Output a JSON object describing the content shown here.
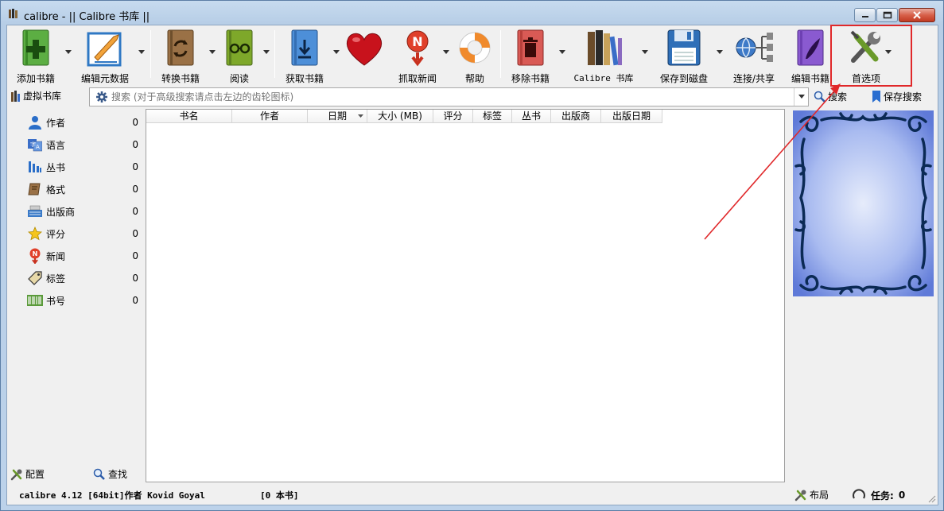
{
  "window": {
    "title": "calibre - || Calibre 书库 ||"
  },
  "toolbar": {
    "items": [
      {
        "id": "add",
        "label": "添加书籍",
        "icon": "add-book-icon"
      },
      {
        "id": "edit_meta",
        "label": "编辑元数据",
        "icon": "edit-metadata-icon"
      },
      {
        "id": "convert",
        "label": "转换书籍",
        "icon": "convert-book-icon"
      },
      {
        "id": "view",
        "label": "阅读",
        "icon": "read-book-icon"
      },
      {
        "id": "fetch",
        "label": "获取书籍",
        "icon": "get-books-icon"
      },
      {
        "id": "donate",
        "label": "",
        "icon": "heart-icon"
      },
      {
        "id": "news",
        "label": "抓取新闻",
        "icon": "fetch-news-icon"
      },
      {
        "id": "help",
        "label": "帮助",
        "icon": "lifebuoy-help-icon"
      },
      {
        "id": "remove",
        "label": "移除书籍",
        "icon": "remove-book-icon"
      },
      {
        "id": "library",
        "label": "Calibre 书库",
        "icon": "library-icon"
      },
      {
        "id": "save",
        "label": "保存到磁盘",
        "icon": "save-disk-icon"
      },
      {
        "id": "connect",
        "label": "连接/共享",
        "icon": "connect-share-icon"
      },
      {
        "id": "tweak",
        "label": "编辑书籍",
        "icon": "edit-book-icon"
      },
      {
        "id": "prefs",
        "label": "首选项",
        "icon": "preferences-icon"
      }
    ]
  },
  "searchbar": {
    "virtual_library": "虚拟书库",
    "placeholder": "搜索 (对于高级搜索请点击左边的齿轮图标)",
    "search_label": "搜索",
    "save_search_label": "保存搜索"
  },
  "tag_browser": {
    "items": [
      {
        "label": "作者",
        "count": "0",
        "icon": "authors-icon"
      },
      {
        "label": "语言",
        "count": "0",
        "icon": "languages-icon"
      },
      {
        "label": "丛书",
        "count": "0",
        "icon": "series-icon"
      },
      {
        "label": "格式",
        "count": "0",
        "icon": "formats-icon"
      },
      {
        "label": "出版商",
        "count": "0",
        "icon": "publisher-icon"
      },
      {
        "label": "评分",
        "count": "0",
        "icon": "rating-star-icon"
      },
      {
        "label": "新闻",
        "count": "0",
        "icon": "news-icon"
      },
      {
        "label": "标签",
        "count": "0",
        "icon": "tags-icon"
      },
      {
        "label": "书号",
        "count": "0",
        "icon": "identifiers-barcode-icon"
      }
    ],
    "configure_label": "配置",
    "find_label": "查找"
  },
  "book_list": {
    "columns": [
      "书名",
      "作者",
      "日期",
      "大小 (MB)",
      "评分",
      "标签",
      "丛书",
      "出版商",
      "出版日期"
    ]
  },
  "status_bar": {
    "version_text": "calibre 4.12 [64bit]作者 Kovid Goyal",
    "book_count": "[0 本书]",
    "layout_label": "布局",
    "jobs_label": "任务: ",
    "jobs_count": "0"
  },
  "colors": {
    "highlight": "#e0282a",
    "cover_bg": "#8fa6e6",
    "cover_ornament": "#0b2a55"
  }
}
